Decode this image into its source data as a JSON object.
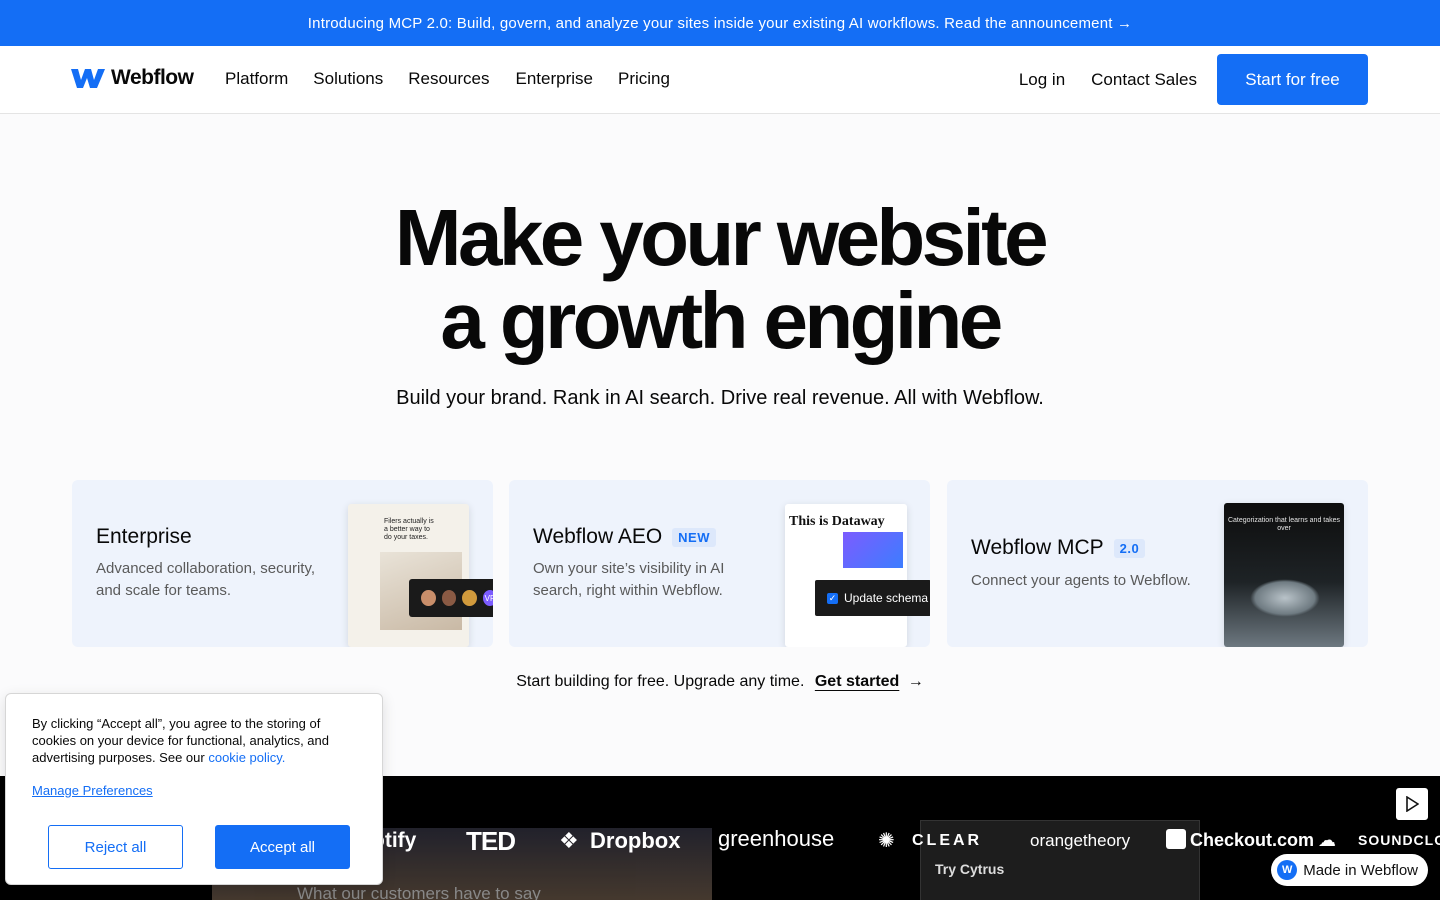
{
  "announcement": {
    "text": "Introducing MCP 2.0: Build, govern, and analyze your sites inside your existing AI workflows. Read the announcement →"
  },
  "nav": {
    "brand": "Webflow",
    "links": [
      "Platform",
      "Solutions",
      "Resources",
      "Enterprise",
      "Pricing"
    ],
    "login": "Log in",
    "contact": "Contact Sales",
    "cta": "Start for free"
  },
  "hero": {
    "title_line1": "Make your website",
    "title_line2": "a growth engine",
    "subtitle": "Build your brand. Rank in AI search. Drive real revenue. All with Webflow."
  },
  "cards": [
    {
      "title": "Enterprise",
      "description_line1": "Advanced collaboration, security,",
      "description_line2": "and scale for teams.",
      "thumb_text": "Filers actually is a better way to do your taxes.",
      "avatar_label": "VF"
    },
    {
      "title": "Webflow AEO",
      "badge": "NEW",
      "description_line1": "Own your site’s visibility in AI",
      "description_line2": "search, right within Webflow.",
      "thumb_heading": "This is Dataway",
      "schema_label": "Update schema"
    },
    {
      "title": "Webflow MCP",
      "badge": "2.0",
      "description_line1": "Connect your agents to Webflow.",
      "thumb_heading": "Categorization that learns and takes over"
    }
  ],
  "cta_line": {
    "text": "Start building for free. Upgrade any time.",
    "link": "Get started",
    "arrow": "→"
  },
  "band": {
    "logos": [
      "otify",
      "TED",
      "Dropbox",
      "greenhouse",
      "CLEAR",
      "orangetheory",
      "Checkout.com",
      "SOUNDCLOU"
    ],
    "video1_text": "What our customers have to say",
    "video2_text": "Try Cytrus",
    "made_in": "Made in Webflow"
  },
  "cookie": {
    "message": "By clicking “Accept all”, you agree to the storing of cookies on your device for functional, analytics, and advertising purposes. See our",
    "policy_link": "cookie policy.",
    "manage": "Manage Preferences",
    "reject": "Reject all",
    "accept": "Accept all"
  },
  "colors": {
    "accent": "#146ef5",
    "card_bg": "#eef3fc",
    "text": "#080808",
    "band_bg": "#000000"
  }
}
